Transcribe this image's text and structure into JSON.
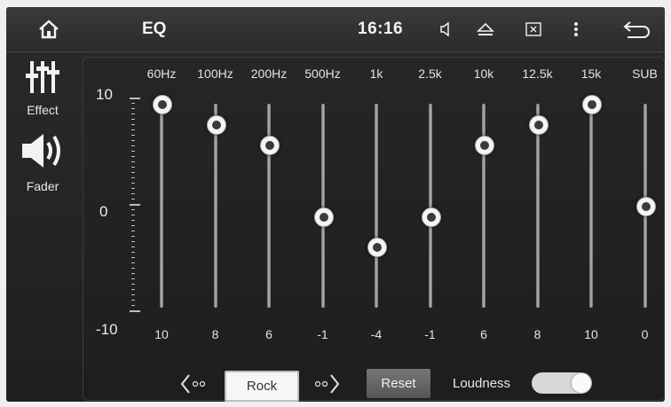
{
  "header": {
    "title": "EQ",
    "time": "16:16",
    "icons": [
      "home-icon",
      "volume-icon",
      "eject-icon",
      "close-screen-icon",
      "more-icon",
      "back-icon"
    ]
  },
  "sidebar": {
    "items": [
      {
        "label": "Effect",
        "icon": "equalizer-icon"
      },
      {
        "label": "Fader",
        "icon": "speaker-icon"
      }
    ]
  },
  "scale": {
    "top": "10",
    "mid": "0",
    "bottom": "-10",
    "min": -10,
    "max": 10
  },
  "bands": [
    {
      "freq": "60Hz",
      "value": 10
    },
    {
      "freq": "100Hz",
      "value": 8
    },
    {
      "freq": "200Hz",
      "value": 6
    },
    {
      "freq": "500Hz",
      "value": -1
    },
    {
      "freq": "1k",
      "value": -4
    },
    {
      "freq": "2.5k",
      "value": -1
    },
    {
      "freq": "10k",
      "value": 6
    },
    {
      "freq": "12.5k",
      "value": 8
    },
    {
      "freq": "15k",
      "value": 10
    },
    {
      "freq": "SUB",
      "value": 0
    }
  ],
  "controls": {
    "preset": "Rock",
    "reset_label": "Reset",
    "loudness_label": "Loudness",
    "loudness_on": true
  }
}
